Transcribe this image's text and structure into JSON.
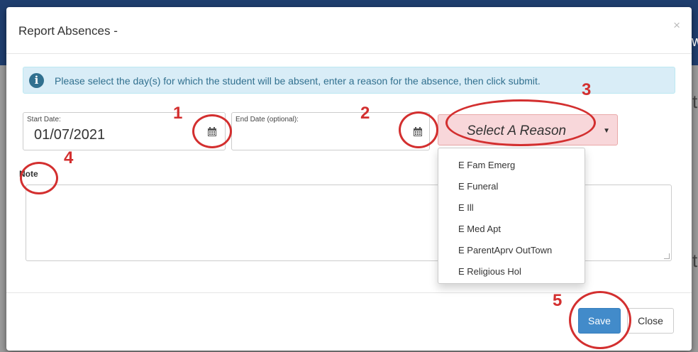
{
  "background": {
    "header_letter": "w",
    "right_letter_1": "t",
    "right_letter_2": "t"
  },
  "modal": {
    "title": "Report Absences -",
    "close_glyph": "×"
  },
  "alert": {
    "icon": "info-icon",
    "text": "Please select the day(s) for which the student will be absent, enter a reason for the absence, then click submit."
  },
  "start_date": {
    "label": "Start Date:",
    "value": "01/07/2021",
    "icon": "calendar-icon"
  },
  "end_date": {
    "label": "End Date (optional):",
    "value": "",
    "icon": "calendar-icon"
  },
  "reason": {
    "selected": "Select A Reason",
    "options": [
      "E Fam Emerg",
      "E Funeral",
      "E Ill",
      "E Med Apt",
      "E ParentAprv OutTown",
      "E Religious Hol"
    ]
  },
  "note": {
    "label": "Note",
    "value": ""
  },
  "footer": {
    "save_label": "Save",
    "close_label": "Close"
  },
  "annotations": {
    "n1": "1",
    "n2": "2",
    "n3": "3",
    "n4": "4",
    "n5": "5",
    "color": "#d32f2f"
  },
  "colors": {
    "primary": "#428bca",
    "info_bg": "#d9edf7",
    "info_text": "#31708f",
    "reason_bg": "#f8d7da"
  }
}
